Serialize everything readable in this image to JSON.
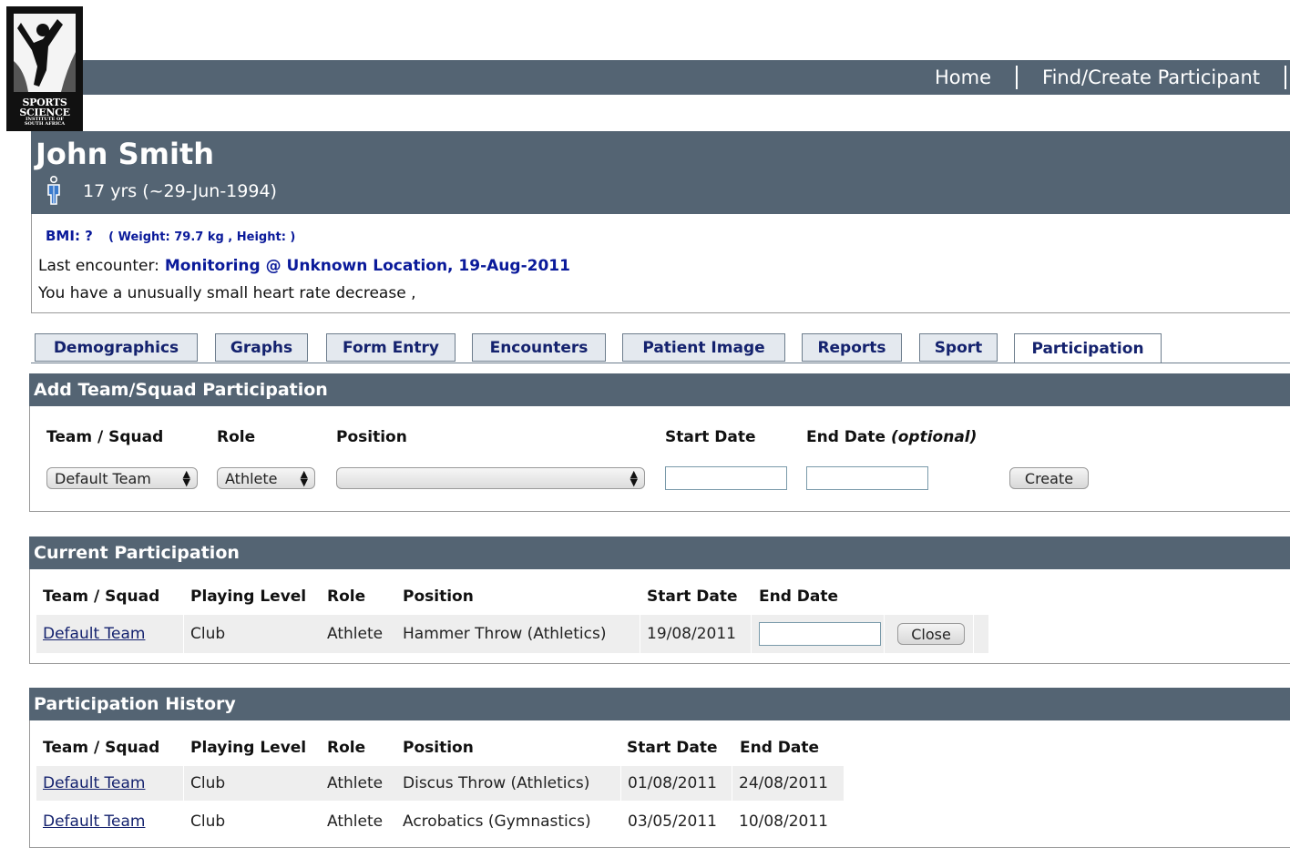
{
  "logo": {
    "alt": "Sports Science Institute of South Africa logo",
    "line1": "SPORTS",
    "line2": "SCIENCE",
    "line3": "INSTITUTE OF",
    "line4": "SOUTH AFRICA"
  },
  "nav": {
    "home": "Home",
    "find_create": "Find/Create Participant"
  },
  "participant": {
    "name": "John Smith",
    "age": "17 yrs (~29-Jun-1994)",
    "gender_icon": "male-person-icon",
    "bmi_label": "BMI: ?",
    "bmi_detail": "( Weight: 79.7 kg , Height: )",
    "last_encounter_label": "Last encounter:",
    "last_encounter_value": "Monitoring @ Unknown Location, 19-Aug-2011",
    "warning": "You have a unusually small heart rate decrease ,"
  },
  "tabs": [
    {
      "label": "Demographics"
    },
    {
      "label": "Graphs"
    },
    {
      "label": "Form Entry"
    },
    {
      "label": "Encounters"
    },
    {
      "label": "Patient Image"
    },
    {
      "label": "Reports"
    },
    {
      "label": "Sport"
    },
    {
      "label": "Participation",
      "active": true
    }
  ],
  "add_panel": {
    "title": "Add Team/Squad Participation",
    "headers": {
      "team": "Team / Squad",
      "role": "Role",
      "position": "Position",
      "start_date": "Start Date",
      "end_date": "End Date",
      "optional": "(optional)"
    },
    "team_selected": "Default Team",
    "role_selected": "Athlete",
    "position_selected": "",
    "start_date_value": "",
    "end_date_value": "",
    "create_label": "Create"
  },
  "current_panel": {
    "title": "Current Participation",
    "headers": [
      "Team / Squad",
      "Playing Level",
      "Role",
      "Position",
      "Start Date",
      "End Date"
    ],
    "rows": [
      {
        "team": "Default Team",
        "level": "Club",
        "role": "Athlete",
        "position": "Hammer Throw (Athletics)",
        "start": "19/08/2011",
        "end_value": "",
        "close_label": "Close"
      }
    ]
  },
  "history_panel": {
    "title": "Participation History",
    "headers": [
      "Team / Squad",
      "Playing Level",
      "Role",
      "Position",
      "Start Date",
      "End Date"
    ],
    "rows": [
      {
        "team": "Default Team",
        "level": "Club",
        "role": "Athlete",
        "position": "Discus Throw (Athletics)",
        "start": "01/08/2011",
        "end": "24/08/2011"
      },
      {
        "team": "Default Team",
        "level": "Club",
        "role": "Athlete",
        "position": "Acrobatics (Gymnastics)",
        "start": "03/05/2011",
        "end": "10/08/2011"
      }
    ]
  },
  "colors": {
    "bar": "#546473",
    "link": "#14226e",
    "info_text": "#0a1a9a",
    "tab_bg": "#e4e9ef"
  }
}
